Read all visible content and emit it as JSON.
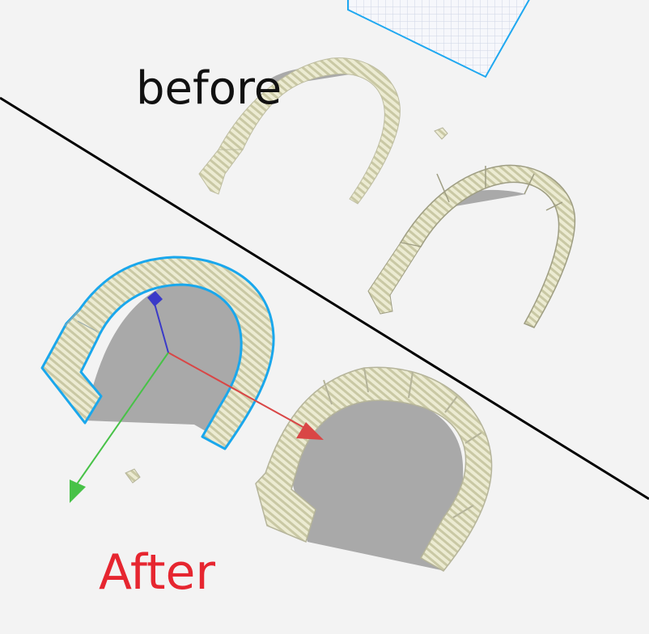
{
  "viewport": {
    "background": "#f3f3f3",
    "build_plate": {
      "grid_color": "#cfd6e6",
      "edge_color": "#1fa8f0"
    }
  },
  "annotations": {
    "before_label": "before",
    "after_label": "After",
    "before_color": "#111111",
    "after_color": "#e62630",
    "divider_color": "#000000"
  },
  "parts": {
    "surface_color": "#ecebd2",
    "stripe_color": "#c9c8a4",
    "shadow_color": "#a9a9a9",
    "selection_outline_color": "#1aa7ec"
  },
  "gizmo": {
    "x_axis_color": "#d94646",
    "y_axis_color": "#47c247",
    "z_axis_color": "#3a3ac8"
  }
}
